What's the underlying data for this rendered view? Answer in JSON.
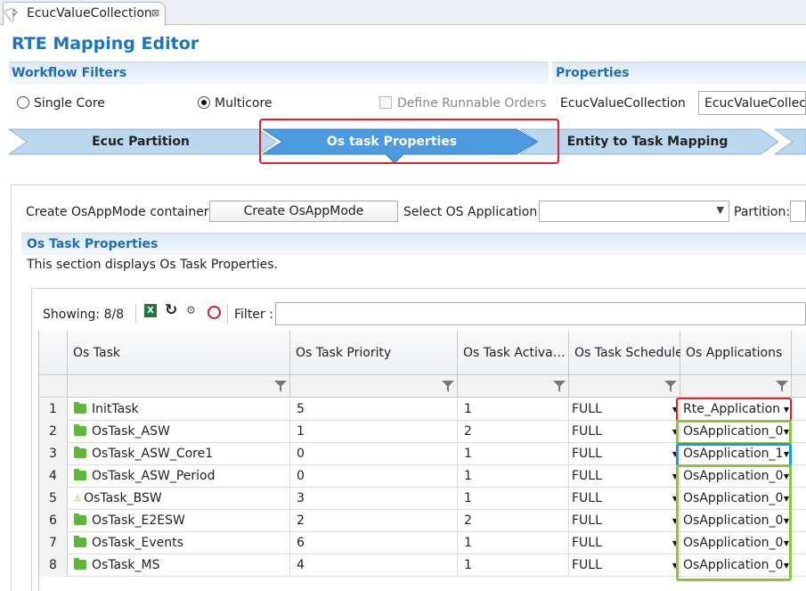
{
  "editor_tab": {
    "label": "EcucValueCollection",
    "close": "⊠",
    "icon": "✧"
  },
  "title": "RTE Mapping Editor",
  "workflow_filters": {
    "header": "Workflow Filters",
    "single_core": "Single Core",
    "multicore": "Multicore",
    "define_runnable_orders": "Define Runnable Orders",
    "selected": "Multicore"
  },
  "properties": {
    "header": "Properties",
    "label": "EcucValueCollection",
    "value": "EcucValueCollecti"
  },
  "workflow_steps": [
    "Ecuc Partition",
    "Os task Properties",
    "Entity to Task Mapping"
  ],
  "active_step": "Os task Properties",
  "toolbar": {
    "create_osappmode_label": "Create OsAppMode container:",
    "create_osappmode_button": "Create OsAppMode",
    "select_os_app_label": "Select OS Application:",
    "select_os_app_value": "",
    "partition_label": "Partition:"
  },
  "section": {
    "header": "Os Task Properties",
    "description": "This section displays Os Task Properties."
  },
  "table": {
    "showing": "Showing: 8/8",
    "filter_label": "Filter :",
    "filter_value": "",
    "columns": [
      "Os Task",
      "Os Task Priority",
      "Os Task Activati...",
      "Os Task Schedule",
      "Os Applications"
    ],
    "rows": [
      {
        "n": "1",
        "task": "InitTask",
        "priority": "5",
        "activation": "1",
        "schedule": "FULL",
        "app": "Rte_Application",
        "warn": false
      },
      {
        "n": "2",
        "task": "OsTask_ASW",
        "priority": "1",
        "activation": "2",
        "schedule": "FULL",
        "app": "OsApplication_0",
        "warn": false
      },
      {
        "n": "3",
        "task": "OsTask_ASW_Core1",
        "priority": "0",
        "activation": "1",
        "schedule": "FULL",
        "app": "OsApplication_1",
        "warn": false
      },
      {
        "n": "4",
        "task": "OsTask_ASW_Period",
        "priority": "0",
        "activation": "1",
        "schedule": "FULL",
        "app": "OsApplication_0",
        "warn": false
      },
      {
        "n": "5",
        "task": "OsTask_BSW",
        "priority": "3",
        "activation": "1",
        "schedule": "FULL",
        "app": "OsApplication_0",
        "warn": true
      },
      {
        "n": "6",
        "task": "OsTask_E2ESW",
        "priority": "2",
        "activation": "2",
        "schedule": "FULL",
        "app": "OsApplication_0",
        "warn": false
      },
      {
        "n": "7",
        "task": "OsTask_Events",
        "priority": "6",
        "activation": "1",
        "schedule": "FULL",
        "app": "OsApplication_0",
        "warn": false
      },
      {
        "n": "8",
        "task": "OsTask_MS",
        "priority": "4",
        "activation": "1",
        "schedule": "FULL",
        "app": "OsApplication_0",
        "warn": false
      }
    ]
  },
  "colors": {
    "accent": "#1a74c6",
    "highlight_red": "#e0202a",
    "highlight_green": "#8cc63f",
    "highlight_blue": "#1e9be0"
  }
}
